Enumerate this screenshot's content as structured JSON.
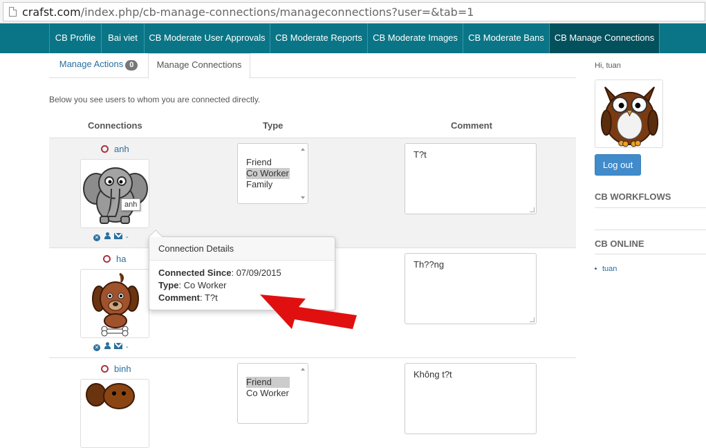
{
  "browser": {
    "url_host": "crafst.com",
    "url_path": "/index.php/cb-manage-connections/manageconnections?user=&tab=1"
  },
  "nav": {
    "tabs": [
      "CB Profile",
      "Bai viet",
      "CB Moderate User Approvals",
      "CB Moderate Reports",
      "CB Moderate Images",
      "CB Moderate Bans",
      "CB Manage Connections"
    ],
    "active_index": 6,
    "bar_color": "#0a7586",
    "active_color": "#04515e"
  },
  "subtabs": {
    "manage_actions": "Manage Actions",
    "manage_actions_count": "0",
    "manage_connections": "Manage Connections"
  },
  "intro": "Below you see users to whom you are connected directly.",
  "table": {
    "headers": {
      "connections": "Connections",
      "type": "Type",
      "comment": "Comment"
    },
    "rows": [
      {
        "name": "anh",
        "avatar_icon": "elephant-avatar-icon",
        "type_options": [
          "Friend",
          "Co Worker",
          "Family"
        ],
        "selected": "Co Worker",
        "comment": "T?t",
        "action_dash": "-"
      },
      {
        "name": "ha",
        "avatar_icon": "dog-avatar-icon",
        "comment": "Th??ng",
        "action_dash": "-"
      },
      {
        "name": "binh",
        "avatar_icon": "beaver-avatar-icon",
        "type_options": [
          "Friend",
          "Co Worker"
        ],
        "selected": "Friend",
        "comment": "Không t?t"
      }
    ]
  },
  "tooltip": "anh",
  "popover": {
    "title": "Connection Details",
    "since_label": "Connected Since",
    "since_value": ": 07/09/2015",
    "type_label": "Type",
    "type_value": ": Co Worker",
    "comment_label": "Comment",
    "comment_value": ": T?t"
  },
  "sidebar": {
    "greeting": "Hi, tuan",
    "avatar_icon": "owl-avatar-icon",
    "logout": "Log out",
    "workflows_title": "CB WORKFLOWS",
    "online_title": "CB ONLINE",
    "online_users": [
      "tuan"
    ]
  },
  "annotation": {
    "arrow_icon": "red-arrow-icon",
    "color": "#e01010"
  }
}
